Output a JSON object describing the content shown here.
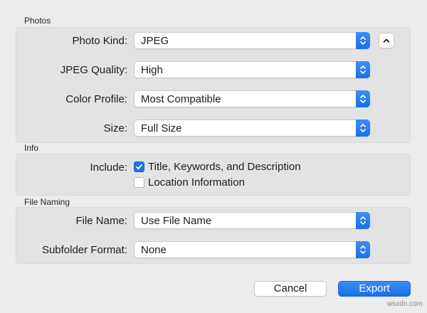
{
  "sections": {
    "photos_title": "Photos",
    "info_title": "Info",
    "file_naming_title": "File Naming"
  },
  "photos": {
    "photo_kind_label": "Photo Kind:",
    "photo_kind_value": "JPEG",
    "jpeg_quality_label": "JPEG Quality:",
    "jpeg_quality_value": "High",
    "color_profile_label": "Color Profile:",
    "color_profile_value": "Most Compatible",
    "size_label": "Size:",
    "size_value": "Full Size",
    "collapse_icon": "chevron-up-icon"
  },
  "info": {
    "include_label": "Include:",
    "options": [
      {
        "label": "Title, Keywords, and Description",
        "checked": true
      },
      {
        "label": "Location Information",
        "checked": false
      }
    ]
  },
  "file_naming": {
    "file_name_label": "File Name:",
    "file_name_value": "Use File Name",
    "subfolder_label": "Subfolder Format:",
    "subfolder_value": "None"
  },
  "buttons": {
    "cancel": "Cancel",
    "export": "Export"
  },
  "watermark": "wsxdn.com",
  "colors": {
    "accent": "#1f74ea",
    "panel": "#e3e3e3",
    "background": "#ececec"
  }
}
